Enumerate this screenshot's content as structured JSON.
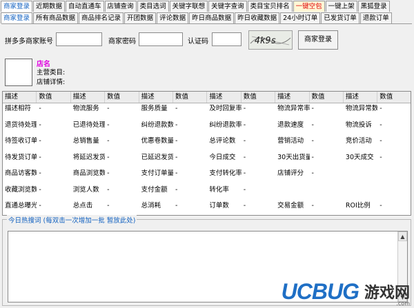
{
  "tabs_row1": [
    {
      "label": "商家登录",
      "state": "active"
    },
    {
      "label": "近期数据",
      "state": ""
    },
    {
      "label": "自动直通车",
      "state": ""
    },
    {
      "label": "店铺查询",
      "state": ""
    },
    {
      "label": "类目选词",
      "state": ""
    },
    {
      "label": "关键字联想",
      "state": ""
    },
    {
      "label": "关键字查询",
      "state": ""
    },
    {
      "label": "类目宝贝排名",
      "state": ""
    },
    {
      "label": "一键空包",
      "state": "hot"
    },
    {
      "label": "一键上架",
      "state": ""
    },
    {
      "label": "黑狐登录",
      "state": ""
    }
  ],
  "tabs_row2": [
    {
      "label": "商家登录",
      "state": "active"
    },
    {
      "label": "所有商品数据",
      "state": ""
    },
    {
      "label": "商品排名记录",
      "state": ""
    },
    {
      "label": "开团数据",
      "state": ""
    },
    {
      "label": "评论数据",
      "state": ""
    },
    {
      "label": "昨日商品数据",
      "state": ""
    },
    {
      "label": "昨日收藏数据",
      "state": ""
    },
    {
      "label": "24小时订单",
      "state": ""
    },
    {
      "label": "已发货订单",
      "state": ""
    },
    {
      "label": "退款订单",
      "state": ""
    }
  ],
  "login": {
    "account_label": "拼多多商家账号",
    "account_value": "",
    "password_label": "商家密码",
    "password_value": "",
    "captcha_label": "认证码",
    "captcha_value": "",
    "captcha_text": "4k9s",
    "login_button": "商家登录"
  },
  "shop": {
    "name": "店名",
    "category_label": "主营类目:",
    "details_label": "店铺详情:"
  },
  "grid": {
    "headers": [
      "描述",
      "数值",
      "描述",
      "数值",
      "描述",
      "数值",
      "描述",
      "数值",
      "描述",
      "数值",
      "描述",
      "数值"
    ],
    "rows": [
      [
        "描述相符",
        "-",
        "物流服务",
        "-",
        "服务质量",
        "-",
        "及时回复率",
        "-",
        "物流异常率",
        "-",
        "物流异常数",
        "-"
      ],
      [
        "退货待处理",
        "-",
        "已退待处理",
        "-",
        "纠纷退款数",
        "-",
        "纠纷退款率",
        "-",
        "退款速度",
        "-",
        "物流投诉",
        "-"
      ],
      [
        "待签收订单",
        "-",
        "总销售量",
        "-",
        "优惠卷数量",
        "-",
        "总评论数",
        "-",
        "营销活动",
        "-",
        "竞价活动",
        "-"
      ],
      [
        "待发货订单",
        "-",
        "将延迟发货",
        "-",
        "已延迟发货",
        "-",
        "今日成交",
        "-",
        "30天出货量",
        "-",
        "30天成交",
        "-"
      ],
      [
        "商品访客数",
        "-",
        "商品浏览数",
        "-",
        "支付订单量",
        "-",
        "支付转化率",
        "-",
        "店铺评分",
        "-",
        "",
        ""
      ],
      [
        "收藏浏览数",
        "-",
        "浏览人数",
        "-",
        "支付金额",
        "-",
        "转化率",
        "-",
        "",
        "",
        "",
        ""
      ],
      [
        "直通总曝光",
        "-",
        "总点击",
        "-",
        "总消耗",
        "-",
        "订单数",
        "-",
        "交易金额",
        "-",
        "ROI比例",
        "-"
      ]
    ]
  },
  "hotwords": {
    "legend": "今日热搜词 (每双击一次增加一批  暂放此处)",
    "content": ""
  },
  "watermark": {
    "brand": "UCBUG",
    "cn": "游戏网",
    "suffix": ".com"
  }
}
